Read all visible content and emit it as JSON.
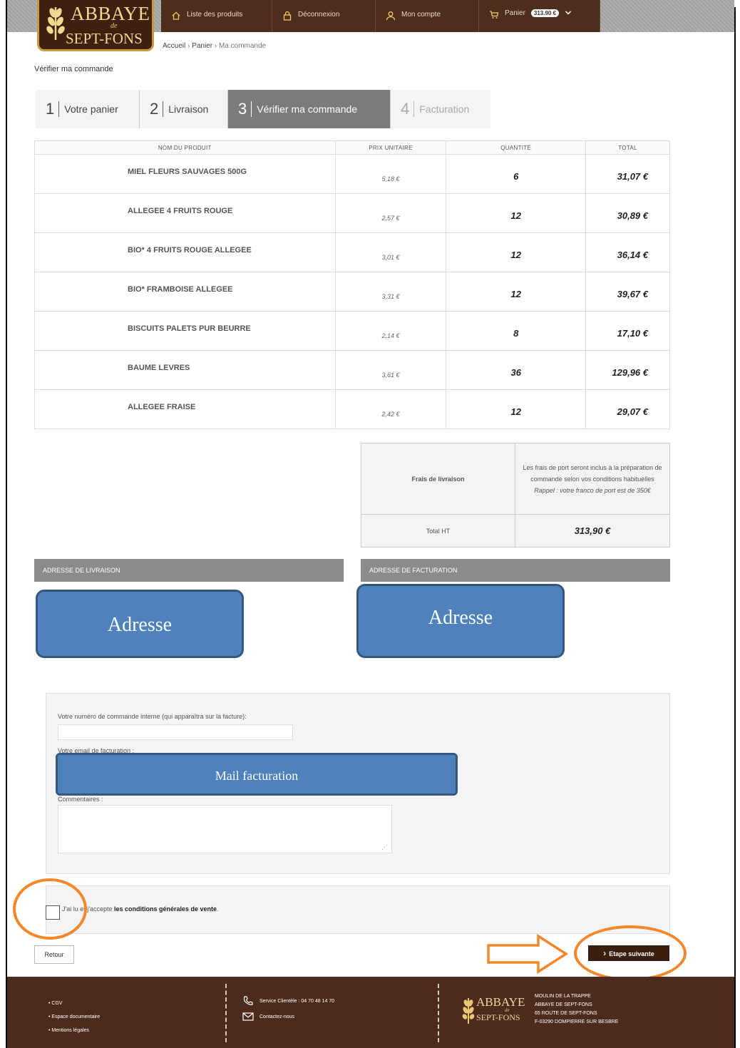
{
  "logo": {
    "line1": "ABBAYE",
    "line2": "de",
    "line3": "SEPT-FONS"
  },
  "nav": {
    "products": "Liste des produits",
    "logout": "Déconnexion",
    "account": "Mon compte",
    "cart": "Panier",
    "cart_amount": "313.90 €"
  },
  "breadcrumb": {
    "home": "Accueil",
    "sep": "›",
    "cart": "Panier",
    "current": "Ma commande"
  },
  "page_title": "Vérifier ma commande",
  "steps": [
    {
      "num": "1",
      "label": "Votre panier"
    },
    {
      "num": "2",
      "label": "Livraison"
    },
    {
      "num": "3",
      "label": "Vérifier ma commande"
    },
    {
      "num": "4",
      "label": "Facturation"
    }
  ],
  "table": {
    "headers": [
      "NOM DU PRODUIT",
      "PRIX UNITAIRE",
      "QUANTITÉ",
      "TOTAL"
    ],
    "rows": [
      {
        "name": "MIEL FLEURS SAUVAGES 500G",
        "unit": "5,18 €",
        "qty": "6",
        "total": "31,07 €"
      },
      {
        "name": "ALLEGEE 4 FRUITS ROUGE",
        "unit": "2,57 €",
        "qty": "12",
        "total": "30,89 €"
      },
      {
        "name": "BIO* 4 FRUITS ROUGE ALLEGEE",
        "unit": "3,01 €",
        "qty": "12",
        "total": "36,14 €"
      },
      {
        "name": "BIO* FRAMBOISE ALLEGEE",
        "unit": "3,31 €",
        "qty": "12",
        "total": "39,67 €"
      },
      {
        "name": "BISCUITS PALETS PUR BEURRE",
        "unit": "2,14 €",
        "qty": "8",
        "total": "17,10 €"
      },
      {
        "name": "BAUME LEVRES",
        "unit": "3,61 €",
        "qty": "36",
        "total": "129,96 €"
      },
      {
        "name": "ALLEGEE FRAISE",
        "unit": "2,42 €",
        "qty": "12",
        "total": "29,07 €"
      }
    ]
  },
  "totals": {
    "delivery_label": "Frais de livraison",
    "delivery_note_1": "Les frais de port seront inclus à la préparation de commande selon vos conditions habituelles",
    "delivery_note_2": "Rappel : votre franco de port est de 350€",
    "total_label": "Total HT",
    "total_value": "313,90 €"
  },
  "delivery_address": {
    "header": "ADRESSE DE LIVRAISON",
    "placeholder": "Adresse"
  },
  "billing_address": {
    "header": "ADRESSE DE FACTURATION",
    "placeholder": "Adresse"
  },
  "form": {
    "order_number_label": "Votre numéro de commande interne (qui apparaîtra sur la facture):",
    "email_label": "Votre email de facturation :",
    "email_overlay": "Mail facturation",
    "comments_label": "Commentaires :"
  },
  "cgv": {
    "prefix": "J'ai lu et j'accepte ",
    "link": "les conditions générales de vente",
    "suffix": "."
  },
  "buttons": {
    "back": "Retour",
    "next": "Etape suivante",
    "next_icon": "›"
  },
  "footer": {
    "links": [
      "CGV",
      "Espace documentaire",
      "Mentions légales"
    ],
    "service": "Service Clientèle : 04 70 48 14 70",
    "contact": "Contactez-nous",
    "address_lines": [
      "MOULIN DE LA TRAPPE",
      "ABBAYE DE SEPT-FONS",
      "65 ROUTE DE SEPT-FONS",
      "F-03290 DOMPIERRE SUR BESBRE"
    ]
  },
  "colors": {
    "brown": "#4d2b1c",
    "gold": "#c79a3b",
    "grey_header": "#8b8b8b",
    "annotation_blue": "#4f81bd",
    "annotation_orange": "#f4872a"
  }
}
